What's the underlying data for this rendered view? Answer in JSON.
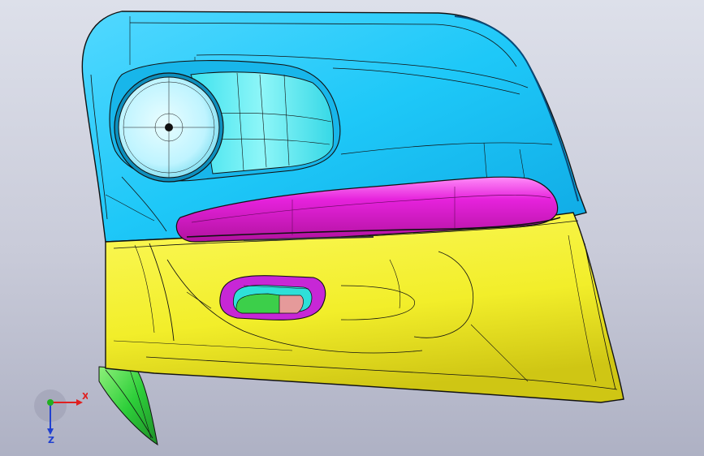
{
  "viewport": {
    "background_top": "#dde0ea",
    "background_bottom": "#aeb1c4"
  },
  "model": {
    "name_icon": "door-trim-panel",
    "colors": {
      "upper_panel": "#1ec8f8",
      "upper_panel_shade": "#0fa9e4",
      "lower_panel": "#f2ee2a",
      "lower_panel_shade": "#d8d11a",
      "armrest": "#e622dc",
      "armrest_highlight": "#ff8cf8",
      "speaker": "#bff4ff",
      "speaker_pocket": "#62ecf2",
      "handle_bezel": "#c727d6",
      "handle_cup": "#2ee0d8",
      "handle_lever": "#3ccf4a",
      "handle_latch": "#e59a9a",
      "flange": "#2ecf3a",
      "edge_line": "#111111"
    }
  },
  "triad": {
    "x_label": "X",
    "z_label": "Z",
    "x_color": "#e02020",
    "y_color": "#20b020",
    "z_color": "#2040d0"
  }
}
